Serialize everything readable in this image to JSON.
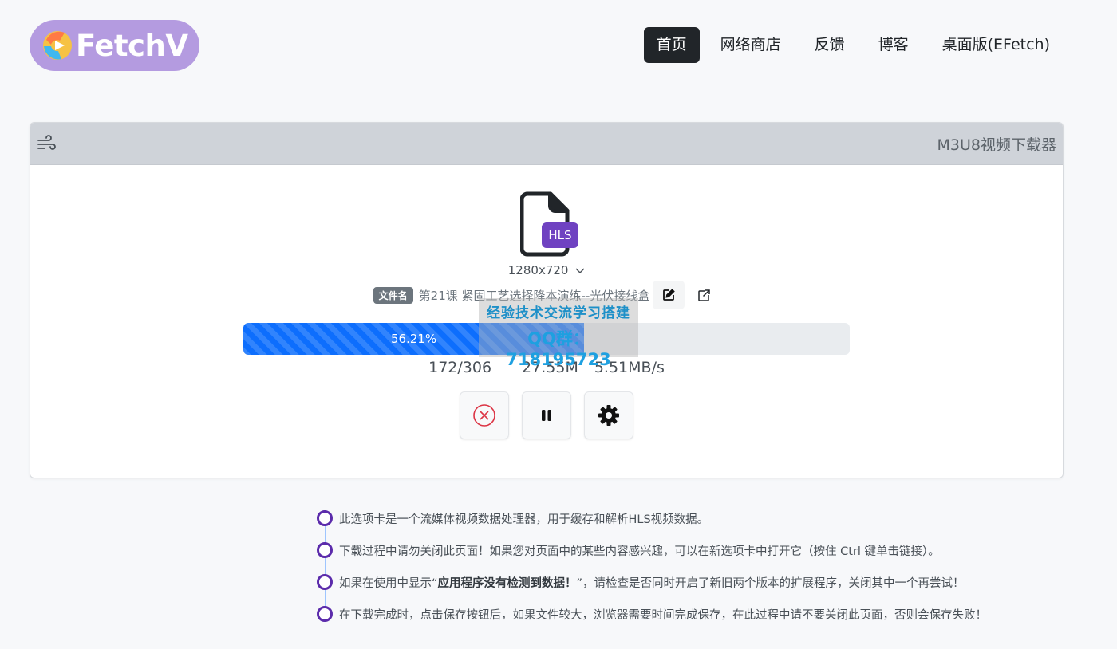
{
  "brand": {
    "name": "FetchV",
    "logo_bg": "#b49be0"
  },
  "nav": {
    "items": [
      {
        "label": "首页",
        "active": true
      },
      {
        "label": "网络商店",
        "active": false
      },
      {
        "label": "反馈",
        "active": false
      },
      {
        "label": "博客",
        "active": false
      },
      {
        "label": "桌面版(EFetch)",
        "active": false
      }
    ]
  },
  "card": {
    "title": "M3U8视频下载器",
    "header_icon": "wind-icon",
    "file_badge": "HLS",
    "resolution": "1280x720",
    "filename_label": "文件名",
    "filename": "第21课 紧固工艺选择降本演练--光伏接线盒",
    "progress": {
      "percent": 56.21,
      "label": "56.21%"
    },
    "stats": {
      "segments": "172/306",
      "size": "27.55M",
      "speed": "5.51MB/s"
    },
    "buttons": [
      "cancel-icon",
      "pause-icon",
      "gear-icon"
    ]
  },
  "watermark": {
    "line1": "经验技术交流学习搭建",
    "line2": "QQ群：718195723"
  },
  "notes": [
    {
      "text": "此选项卡是一个流媒体视频数据处理器，用于缓存和解析HLS视频数据。"
    },
    {
      "text": "下载过程中请勿关闭此页面！如果您对页面中的某些内容感兴趣，可以在新选项卡中打开它（按住 Ctrl 键单击链接）。"
    },
    {
      "pre": "如果在使用中显示“",
      "bold": "应用程序没有检测到数据！",
      "post": "”，请检查是否同时开启了新旧两个版本的扩展程序，关闭其中一个再尝试！"
    },
    {
      "text": "在下载完成时，点击保存按钮后，如果文件较大，浏览器需要时间完成保存，在此过程中请不要关闭此页面，否则会保存失败！"
    }
  ],
  "colors": {
    "accent": "#0d6efd",
    "badge_purple": "#6f42c1",
    "dark": "#212529",
    "timeline_dot": "#5b2bab"
  }
}
